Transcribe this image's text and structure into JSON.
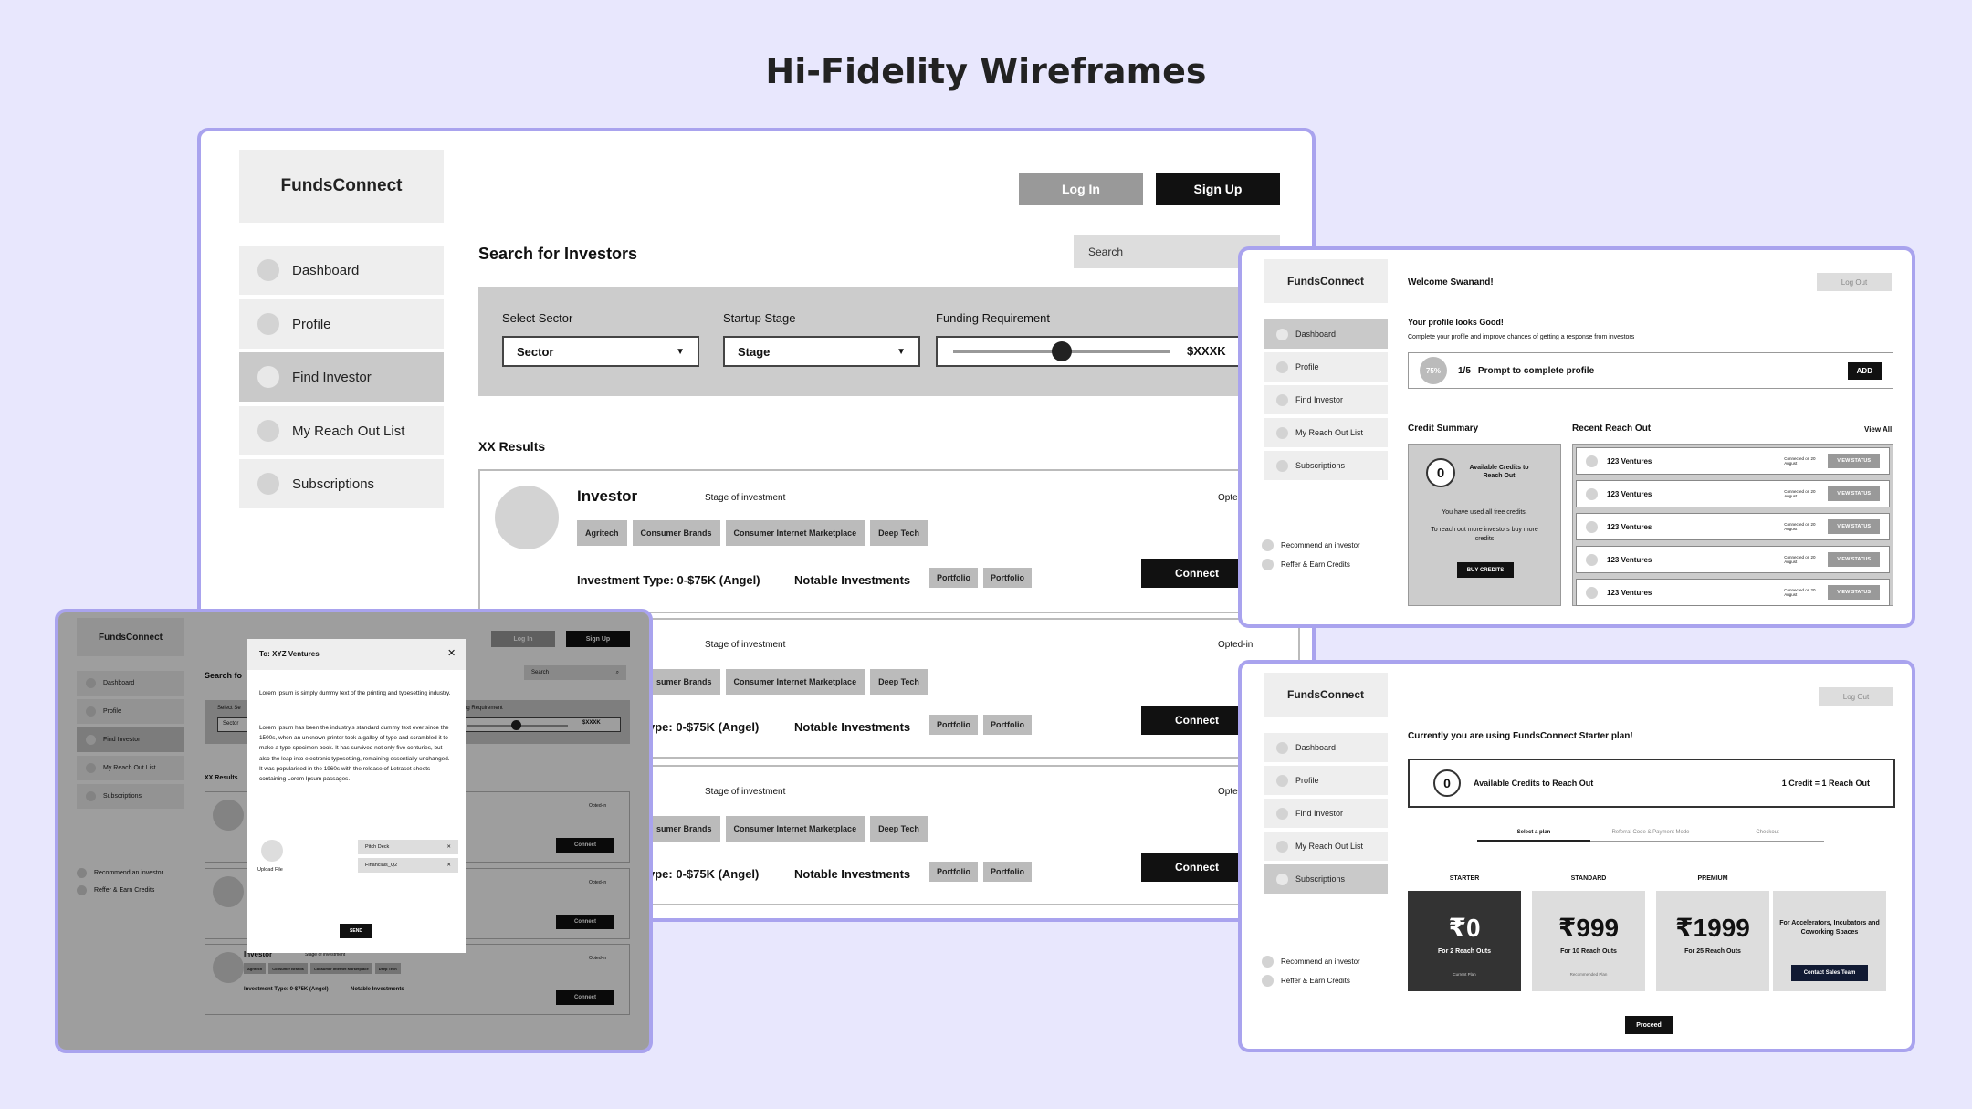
{
  "page_title": "Hi-Fidelity Wireframes",
  "brand": "FundsConnect",
  "nav": {
    "dashboard": "Dashboard",
    "profile": "Profile",
    "find_investor": "Find Investor",
    "reach_out": "My Reach Out List",
    "subscriptions": "Subscriptions"
  },
  "auth": {
    "login": "Log In",
    "signup": "Sign Up",
    "logout": "Log Out"
  },
  "search": {
    "heading": "Search for Investors",
    "placeholder": "Search",
    "sector_label": "Select Sector",
    "sector_value": "Sector",
    "stage_label": "Startup Stage",
    "stage_value": "Stage",
    "funding_label": "Funding Requirement",
    "funding_value": "$XXXK",
    "funding_slider_fraction": 0.5,
    "results": "XX Results"
  },
  "investor": {
    "name": "Investor",
    "stage": "Stage of investment",
    "opted": "Opted-in",
    "tags": [
      "Agritech",
      "Consumer Brands",
      "Consumer Internet Marketplace",
      "Deep Tech"
    ],
    "tags_cut": [
      "sumer Brands",
      "Consumer Internet Marketplace",
      "Deep Tech"
    ],
    "investment": "Investment Type: 0-$75K (Angel)",
    "investment_cut": "ype: 0-$75K (Angel)",
    "notable": "Notable Investments",
    "portfolio": "Portfolio",
    "connect": "Connect",
    "opted_cut": "Opted"
  },
  "dashboard": {
    "welcome": "Welcome Swanand!",
    "profile_title": "Your profile looks Good!",
    "profile_sub": "Complete your profile and improve chances of getting a response from investors",
    "progress": "75%",
    "prompt_step": "1/5",
    "prompt_text": "Prompt to complete profile",
    "add": "ADD",
    "credit_summary": "Credit Summary",
    "credits_count": "0",
    "available_credits": "Available Credits to Reach Out",
    "used_all": "You have used all free credits.",
    "buy_more": "To reach out more investors buy more credits",
    "buy_credits": "BUY CREDITS",
    "recent": "Recent Reach Out",
    "view_all": "View All",
    "ventures": [
      "123 Ventures",
      "123 Ventures",
      "123 Ventures",
      "123 Ventures",
      "123 Ventures"
    ],
    "connected_on": "Connected on 20 August",
    "view_status": "VIEW STATUS",
    "recommend": "Recommend an investor",
    "refer": "Reffer & Earn Credits"
  },
  "subs": {
    "current": "Currently you are using FundsConnect Starter plan!",
    "credits_count": "0",
    "available": "Available Credits to Reach Out",
    "rate": "1 Credit = 1 Reach Out",
    "steps": [
      "Select a plan",
      "Referral Code & Payment Mode",
      "Checkout"
    ],
    "plans": [
      {
        "label": "STARTER",
        "price": "₹0",
        "desc": "For 2 Reach Outs",
        "note": "Current Plan"
      },
      {
        "label": "STANDARD",
        "price": "₹999",
        "desc": "For 10 Reach Outs",
        "note": "Recommended Plan"
      },
      {
        "label": "PREMIUM",
        "price": "₹1999",
        "desc": "For 25 Reach Outs",
        "note": ""
      }
    ],
    "enterprise": "For Accelerators, Incubators and Coworking Spaces",
    "contact": "Contact Sales Team",
    "proceed": "Proceed"
  },
  "modal": {
    "to": "To: XYZ Ventures",
    "para1": "Lorem Ipsum is simply dummy text of the printing and typesetting industry.",
    "para2": "Lorem Ipsum has been the industry's standard dummy text ever since the 1500s, when an unknown printer took a galley of type and scrambled it to make a type specimen book. It has survived not only five centuries, but also the leap into electronic typesetting, remaining essentially unchanged. It was popularised in the 1960s with the release of Letraset sheets containing Lorem Ipsum passages.",
    "upload": "Upload File",
    "files": [
      "Pitch Deck",
      "Financials_Q2"
    ],
    "send": "SEND",
    "search_short": "Search fo",
    "funding_cut": "ng Requirement",
    "sector_cut": "Select Se",
    "sector_val_cut": "Sector"
  }
}
